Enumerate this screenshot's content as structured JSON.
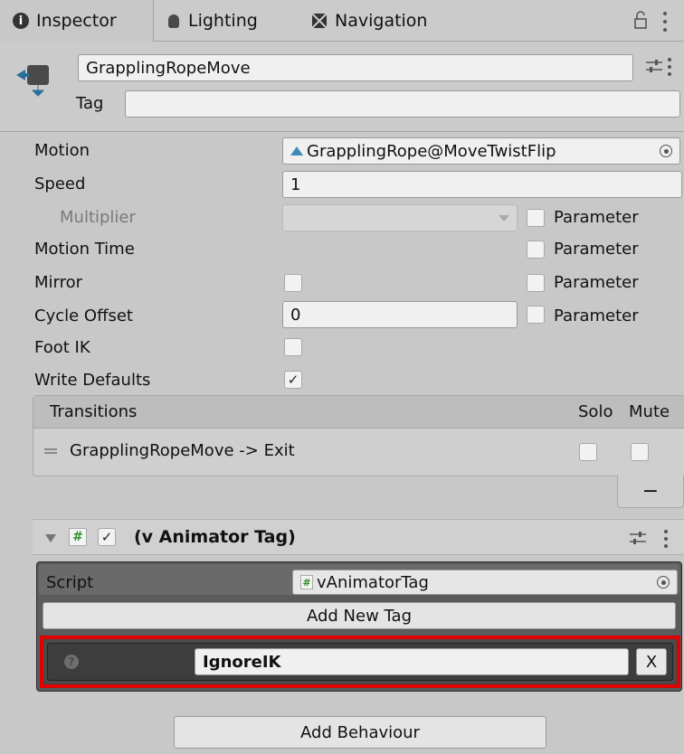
{
  "tabs": [
    {
      "label": "Inspector",
      "icon": "info-icon"
    },
    {
      "label": "Lighting",
      "icon": "bulb-icon"
    },
    {
      "label": "Navigation",
      "icon": "navmesh-icon"
    }
  ],
  "header": {
    "object_name": "GrapplingRopeMove",
    "tag_label": "Tag",
    "tag_value": ""
  },
  "state": {
    "motion_label": "Motion",
    "motion_value": "GrapplingRope@MoveTwistFlip",
    "speed_label": "Speed",
    "speed_value": "1",
    "multiplier_label": "Multiplier",
    "motion_time_label": "Motion Time",
    "mirror_label": "Mirror",
    "cycle_offset_label": "Cycle Offset",
    "cycle_offset_value": "0",
    "foot_ik_label": "Foot IK",
    "write_defaults_label": "Write Defaults",
    "write_defaults_checked": "✓",
    "parameter_label": "Parameter"
  },
  "transitions": {
    "header": "Transitions",
    "solo": "Solo",
    "mute": "Mute",
    "rows": [
      {
        "label": "GrapplingRopeMove -> Exit"
      }
    ],
    "remove_label": "−"
  },
  "component": {
    "title": "(v Animator Tag)",
    "enabled_check": "✓",
    "hash_icon_text": "#",
    "script_label": "Script",
    "script_value": "vAnimatorTag",
    "add_tag_label": "Add New Tag",
    "tag_entry_value": "IgnoreIK",
    "remove_tag_label": "X"
  },
  "add_behaviour_label": "Add Behaviour",
  "colors": {
    "highlight": "#e00000",
    "panel_dark": "#5b5b5b"
  }
}
